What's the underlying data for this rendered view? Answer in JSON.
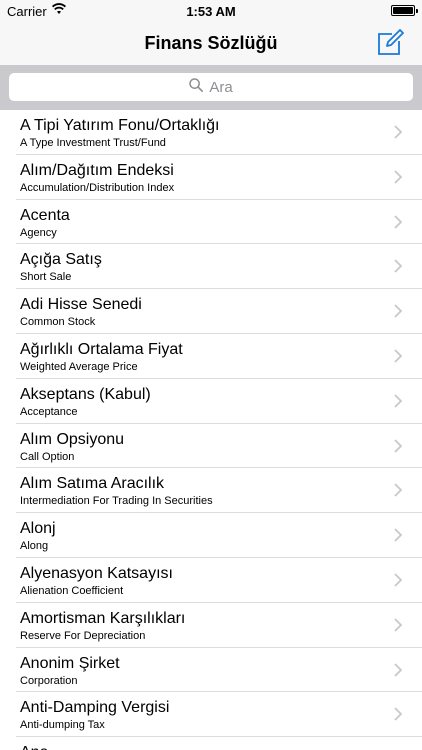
{
  "status_bar": {
    "carrier": "Carrier",
    "time": "1:53 AM"
  },
  "nav": {
    "title": "Finans Sözlüğü",
    "compose_icon": "compose-icon"
  },
  "search": {
    "placeholder": "Ara"
  },
  "colors": {
    "tint": "#1a7ad9",
    "chevron": "#c7c7cc",
    "search_bg": "#c9c9ce"
  },
  "terms": [
    {
      "title": "A Tipi Yatırım Fonu/Ortaklığı",
      "subtitle": "A Type Investment Trust/Fund"
    },
    {
      "title": "Alım/Dağıtım Endeksi",
      "subtitle": "Accumulation/Distribution Index"
    },
    {
      "title": "Acenta",
      "subtitle": "Agency"
    },
    {
      "title": "Açığa Satış",
      "subtitle": "Short Sale"
    },
    {
      "title": "Adi Hisse Senedi",
      "subtitle": "Common Stock"
    },
    {
      "title": "Ağırlıklı Ortalama Fiyat",
      "subtitle": "Weighted Average Price"
    },
    {
      "title": "Akseptans (Kabul)",
      "subtitle": "Acceptance"
    },
    {
      "title": "Alım Opsiyonu",
      "subtitle": "Call Option"
    },
    {
      "title": "Alım Satıma Aracılık",
      "subtitle": "Intermediation For Trading In Securities"
    },
    {
      "title": "Alonj",
      "subtitle": "Along"
    },
    {
      "title": "Alyenasyon Katsayısı",
      "subtitle": "Alienation Coefficient"
    },
    {
      "title": "Amortisman Karşılıkları",
      "subtitle": "Reserve For Depreciation"
    },
    {
      "title": "Anonim Şirket",
      "subtitle": "Corporation"
    },
    {
      "title": "Anti-Damping Vergisi",
      "subtitle": "Anti-dumping Tax"
    },
    {
      "title": "Ana",
      "subtitle": ""
    }
  ]
}
